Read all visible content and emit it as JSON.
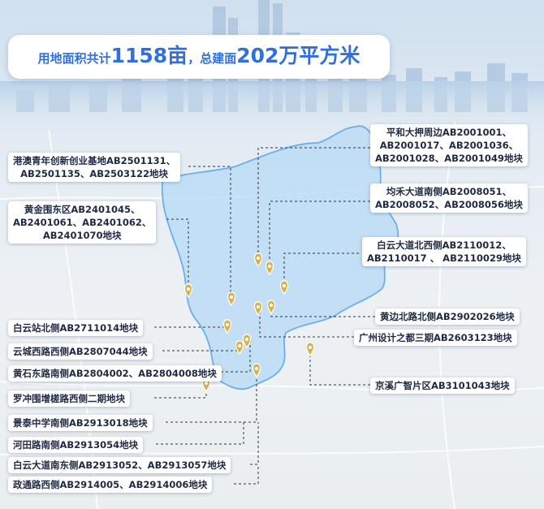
{
  "title": {
    "prefix": "用地面积共计",
    "area_value": "1158亩",
    "separator": "，",
    "middle": "总建面",
    "floor_value": "202万平方米"
  },
  "labels": {
    "gangao": [
      "港澳青年创新创业基地AB2501131、",
      "AB2501135、AB2503122地块"
    ],
    "huangjinwei": [
      "黄金围东区AB2401045、",
      "AB2401061、AB2401062、",
      "AB2401070地块"
    ],
    "baiyunzhan": "白云站北侧AB2711014地块",
    "yuncheng": "云城西路西侧AB2807044地块",
    "huangshi": "黄石东路南侧AB2804002、AB2804008地块",
    "luochong": "罗冲围增槎路西侧二期地块",
    "jingtai": "景泰中学南侧AB2913018地块",
    "hetian": "河田路南侧AB2913054地块",
    "baiyundadaonan": "白云大道南东侧AB2913052、AB2913057地块",
    "zhenglu": "政通路西侧AB2914005、AB2914006地块",
    "pinghe": [
      "平和大押周边AB2001001、",
      "AB2001017、AB2001036、",
      "AB2001028、AB2001049地块"
    ],
    "junhe": [
      "均禾大道南侧AB2008051、",
      "AB2008052、AB2008056地块"
    ],
    "baiyundadaobei": [
      "白云大道北西侧AB2110012、",
      "AB2110017 、 AB2110029地块"
    ],
    "huangbian": "黄边北路北侧AB2902026地块",
    "guangzhousheji": "广州设计之都三期AB2603123地块",
    "jingxi": "京溪广智片区AB3101043地块"
  },
  "colors": {
    "accent": "#2f6fe0",
    "district_fill": "#bcdcf5",
    "district_stroke": "#6aaef0",
    "pin": "#d8b24a"
  }
}
